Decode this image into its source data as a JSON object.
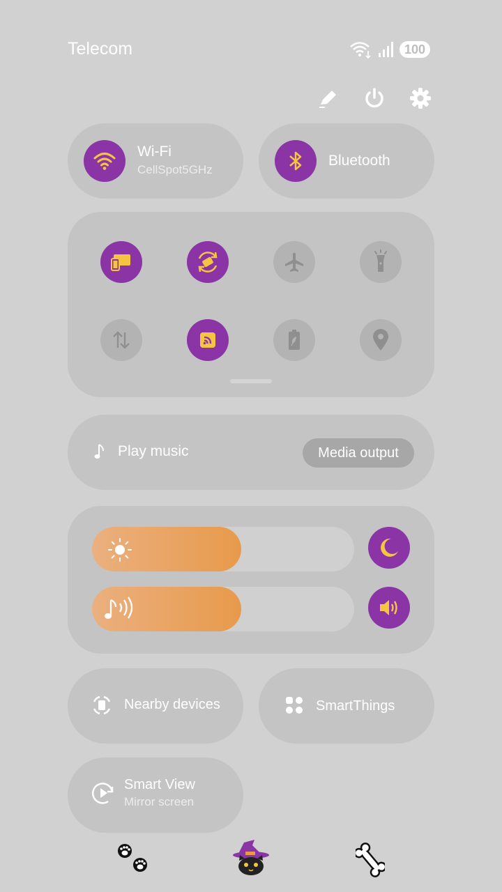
{
  "status_bar": {
    "carrier": "Telecom",
    "battery": "100"
  },
  "top_actions": {
    "edit": "pencil-icon",
    "power": "power-icon",
    "settings": "gear-icon"
  },
  "wifi": {
    "label": "Wi-Fi",
    "network": "CellSpot5GHz",
    "on": true
  },
  "bluetooth": {
    "label": "Bluetooth",
    "on": true
  },
  "quick_toggles": [
    {
      "name": "cast-screen",
      "on": true
    },
    {
      "name": "auto-rotate",
      "on": true
    },
    {
      "name": "airplane-mode",
      "on": false
    },
    {
      "name": "flashlight",
      "on": false
    },
    {
      "name": "mobile-data",
      "on": false
    },
    {
      "name": "mobile-hotspot",
      "on": true
    },
    {
      "name": "power-saving",
      "on": false
    },
    {
      "name": "location",
      "on": false
    }
  ],
  "media": {
    "label": "Play music",
    "output_button": "Media output"
  },
  "sliders": {
    "brightness": 0.57,
    "volume": 0.57
  },
  "tiles": {
    "nearby": "Nearby devices",
    "smartthings": "SmartThings",
    "smartview_title": "Smart View",
    "smartview_sub": "Mirror screen"
  },
  "nav": [
    "paw-prints-icon",
    "witch-cat-icon",
    "bone-icon"
  ],
  "colors": {
    "accent": "#8a34a6",
    "icon_on": "#f5c542",
    "panel": "#c4c4c4",
    "background": "#d1d1d1",
    "slider": "#e89a4b"
  }
}
